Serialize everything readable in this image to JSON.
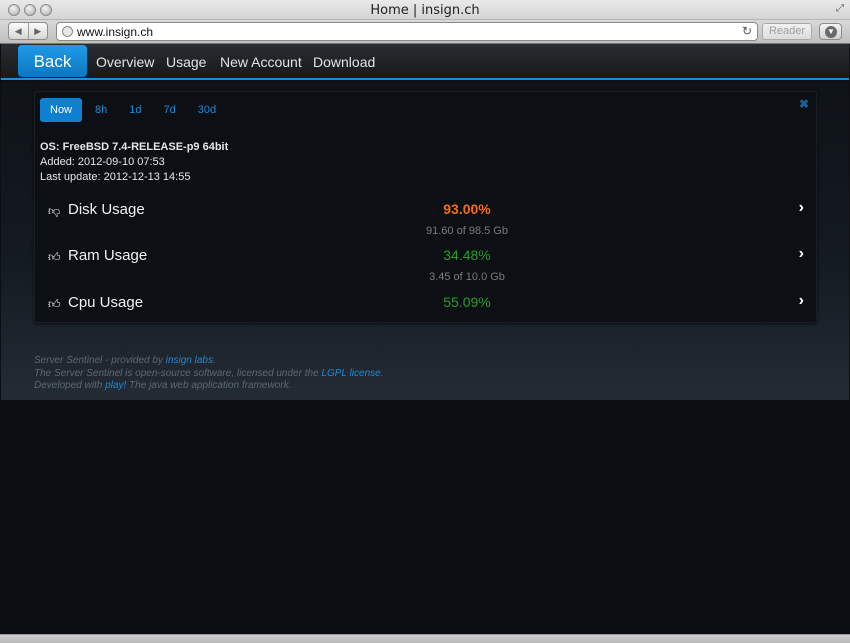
{
  "browser": {
    "window_title": "Home | insign.ch",
    "url": "www.insign.ch",
    "reader_label": "Reader"
  },
  "nav": {
    "back_label": "Back",
    "links": [
      "Overview",
      "Usage",
      "New Account",
      "Download"
    ]
  },
  "tabs": [
    "Now",
    "8h",
    "1d",
    "7d",
    "30d"
  ],
  "server": {
    "os": "OS: FreeBSD 7.4-RELEASE-p9 64bit",
    "added": "Added: 2012-09-10 07:53",
    "last_update": "Last update: 2012-12-13 14:55"
  },
  "metrics": [
    {
      "label": "Disk Usage",
      "percent": "93.00%",
      "detail": "91.60 of 98.5 Gb",
      "status_icon": "thumbs-down-icon",
      "color": "#f26c1d"
    },
    {
      "label": "Ram Usage",
      "percent": "34.48%",
      "detail": "3.45 of 10.0 Gb",
      "status_icon": "thumbs-up-icon",
      "color": "#2a9b2a"
    },
    {
      "label": "Cpu Usage",
      "percent": "55.09%",
      "detail": "",
      "status_icon": "thumbs-up-icon",
      "color": "#2a9b2a"
    }
  ],
  "footer": {
    "line1_prefix": "Server Sentinel - provided by ",
    "line1_link": "insign labs",
    "line1_suffix": ".",
    "line2_prefix": "The Server Sentinel is open-source software, licensed under the ",
    "line2_link": "LGPL license",
    "line2_suffix": ".",
    "line3_prefix": "Developed with ",
    "line3_link": "play!",
    "line3_suffix": " The java web application framework."
  },
  "colors": {
    "accent": "#1f8ad4",
    "warning": "#f26c1d",
    "ok": "#2a9b2a"
  }
}
